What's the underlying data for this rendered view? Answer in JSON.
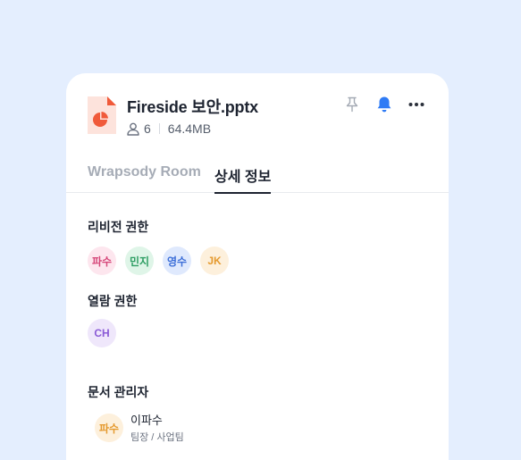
{
  "file": {
    "title": "Fireside 보안.pptx",
    "member_count": "6",
    "size": "64.4MB",
    "icon": "pptx-file-icon",
    "icon_color": "#f05a3a"
  },
  "actions": {
    "pin_icon": "pin-icon",
    "bell_icon": "bell-icon",
    "more_icon": "more-icon",
    "bell_color": "#2f7bf5"
  },
  "tabs": [
    {
      "label": "Wrapsody Room",
      "active": false
    },
    {
      "label": "상세 정보",
      "active": true
    }
  ],
  "revision": {
    "label": "리비전 권한",
    "members": [
      {
        "initials": "파수",
        "bg": "#fde6ee",
        "fg": "#d6487a"
      },
      {
        "initials": "민지",
        "bg": "#dff5e8",
        "fg": "#2e9e63"
      },
      {
        "initials": "영수",
        "bg": "#dfe9fd",
        "fg": "#3d6fd8"
      },
      {
        "initials": "JK",
        "bg": "#fdf0dc",
        "fg": "#e59a2f"
      }
    ]
  },
  "view": {
    "label": "열람 권한",
    "members": [
      {
        "initials": "CH",
        "bg": "#efe7fb",
        "fg": "#8b5bd6"
      }
    ]
  },
  "manager": {
    "label": "문서 관리자",
    "initials": "파수",
    "bg": "#fdf0dc",
    "fg": "#e59a2f",
    "name": "이파수",
    "role": "팀장 / 사업팀"
  }
}
